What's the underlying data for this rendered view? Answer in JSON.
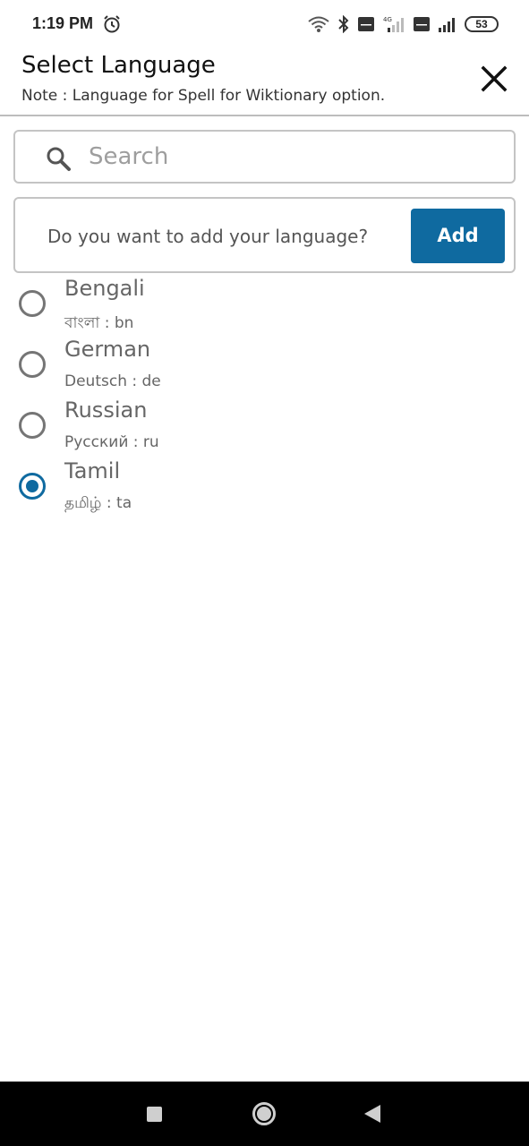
{
  "status_bar": {
    "time": "1:19 PM",
    "battery": "53",
    "network_label": "4G",
    "icons": [
      "alarm-icon",
      "wifi-icon",
      "bluetooth-icon",
      "volte-icon",
      "signal-icon",
      "volte-icon",
      "signal-icon",
      "battery-icon"
    ]
  },
  "header": {
    "title": "Select Language",
    "note": "Note : Language for Spell for Wiktionary option.",
    "close_icon": "close-icon"
  },
  "search": {
    "placeholder": "Search",
    "value": "",
    "icon": "search-icon"
  },
  "add_language": {
    "question": "Do you want to add your language?",
    "button_label": "Add"
  },
  "languages": [
    {
      "name": "Bengali",
      "native": "বাংলা : bn",
      "selected": false
    },
    {
      "name": "German",
      "native": "Deutsch : de",
      "selected": false
    },
    {
      "name": "Russian",
      "native": "Русский : ru",
      "selected": false
    },
    {
      "name": "Tamil",
      "native": "தமிழ் : ta",
      "selected": true
    }
  ],
  "nav_bar": {
    "icons": [
      "recent-apps-icon",
      "home-icon",
      "back-icon"
    ]
  },
  "colors": {
    "accent": "#0f6aa0",
    "radio_unselected": "#757575",
    "text_secondary": "#666666",
    "border": "#c4c4c4"
  }
}
